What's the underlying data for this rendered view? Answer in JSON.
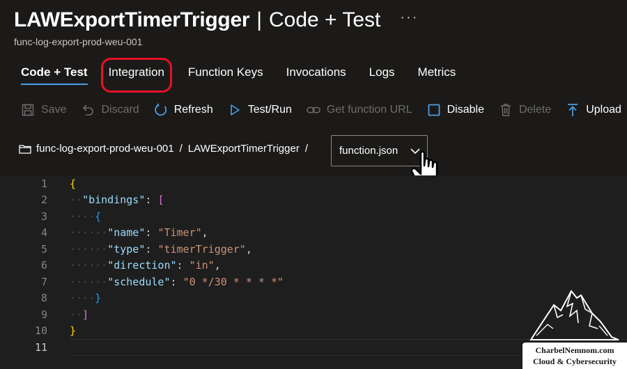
{
  "header": {
    "title_main": "LAWExportTimerTrigger",
    "title_separator": "|",
    "title_section": "Code + Test",
    "more_label": "···",
    "subtitle": "func-log-export-prod-weu-001"
  },
  "tabs": [
    {
      "label": "Code + Test",
      "active": true
    },
    {
      "label": "Integration",
      "highlighted": true
    },
    {
      "label": "Function Keys"
    },
    {
      "label": "Invocations"
    },
    {
      "label": "Logs"
    },
    {
      "label": "Metrics"
    }
  ],
  "toolbar": {
    "save": {
      "label": "Save",
      "icon": "save-icon",
      "enabled": false
    },
    "discard": {
      "label": "Discard",
      "icon": "undo-icon",
      "enabled": false
    },
    "refresh": {
      "label": "Refresh",
      "icon": "refresh-icon",
      "enabled": true
    },
    "testrun": {
      "label": "Test/Run",
      "icon": "play-icon",
      "enabled": true
    },
    "geturl": {
      "label": "Get function URL",
      "icon": "link-icon",
      "enabled": false
    },
    "disable": {
      "label": "Disable",
      "icon": "checkbox-icon",
      "enabled": true
    },
    "delete": {
      "label": "Delete",
      "icon": "trash-icon",
      "enabled": false
    },
    "upload": {
      "label": "Upload",
      "icon": "upload-icon",
      "enabled": true
    }
  },
  "breadcrumb": {
    "app": "func-log-export-prod-weu-001",
    "separator": "/",
    "function": "LAWExportTimerTrigger",
    "file_select_value": "function.json"
  },
  "editor": {
    "line_numbers": [
      "1",
      "2",
      "3",
      "4",
      "5",
      "6",
      "7",
      "8",
      "9",
      "10",
      "11"
    ],
    "tokens": {
      "open_brace": "{",
      "bindings_key": "\"bindings\"",
      "colon": ": ",
      "open_bracket": "[",
      "name_key": "\"name\"",
      "name_val": "\"Timer\"",
      "type_key": "\"type\"",
      "type_val": "\"timerTrigger\"",
      "direction_key": "\"direction\"",
      "direction_val": "\"in\"",
      "schedule_key": "\"schedule\"",
      "schedule_val": "\"0 */30 * * * *\"",
      "comma": ",",
      "close_inner_brace": "}",
      "close_bracket": "]",
      "close_brace": "}"
    }
  },
  "branding": {
    "line1": "CharbelNemnom.com",
    "line2": "Cloud & Cybersecurity"
  },
  "colors": {
    "background": "#1b1a19",
    "editor_bg": "#1e1e1e",
    "accent": "#4aa0e6",
    "highlight_box": "#e81123",
    "disabled_text": "#6e6d6c"
  }
}
